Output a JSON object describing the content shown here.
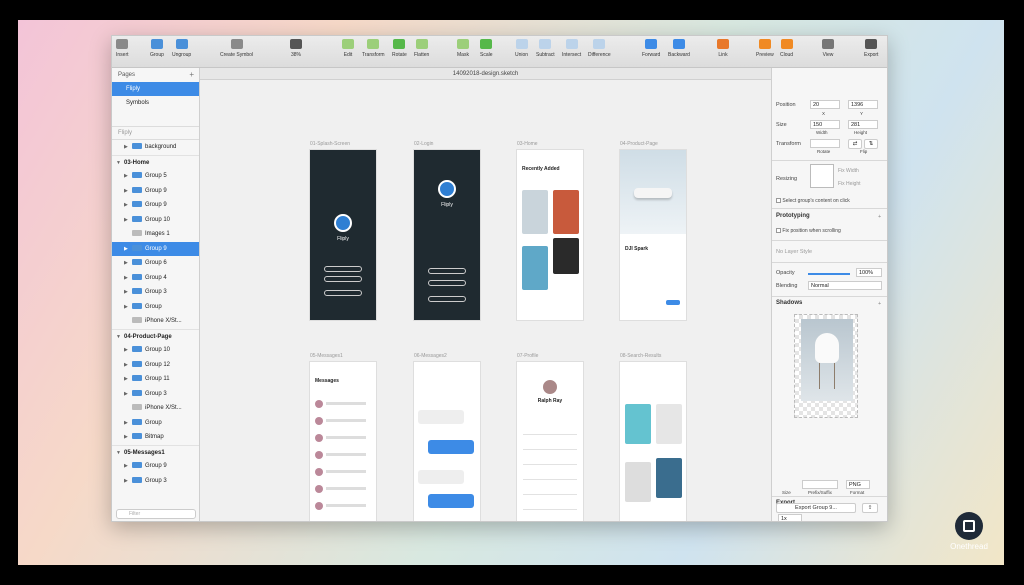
{
  "window": {
    "doc_title": "14092018-design.sketch"
  },
  "toolbar": {
    "items": [
      {
        "label": "Insert",
        "icon": "insert-icon"
      },
      {
        "label": "Group",
        "icon": "group-icon"
      },
      {
        "label": "Ungroup",
        "icon": "ungroup-icon"
      },
      {
        "label": "Create Symbol",
        "icon": "symbol-icon"
      },
      {
        "label": "38%",
        "icon": "zoom-icon"
      },
      {
        "label": "Edit",
        "icon": "edit-icon"
      },
      {
        "label": "Transform",
        "icon": "transform-icon"
      },
      {
        "label": "Rotate",
        "icon": "rotate-icon"
      },
      {
        "label": "Flatten",
        "icon": "flatten-icon"
      },
      {
        "label": "Mask",
        "icon": "mask-icon"
      },
      {
        "label": "Scale",
        "icon": "scale-icon"
      },
      {
        "label": "Union",
        "icon": "union-icon"
      },
      {
        "label": "Subtract",
        "icon": "subtract-icon"
      },
      {
        "label": "Intersect",
        "icon": "intersect-icon"
      },
      {
        "label": "Difference",
        "icon": "difference-icon"
      },
      {
        "label": "Forward",
        "icon": "forward-icon"
      },
      {
        "label": "Backward",
        "icon": "backward-icon"
      },
      {
        "label": "Link",
        "icon": "link-icon"
      },
      {
        "label": "Preview",
        "icon": "preview-icon"
      },
      {
        "label": "Cloud",
        "icon": "cloud-icon"
      },
      {
        "label": "View",
        "icon": "view-icon"
      },
      {
        "label": "Export",
        "icon": "export-icon"
      }
    ]
  },
  "sidebar": {
    "pages_title": "Pages",
    "pages": [
      "Fliply",
      "Symbols"
    ],
    "layers_title": "Fliply",
    "filter_placeholder": "Filter",
    "layers": [
      {
        "label": "background",
        "type": "folder",
        "indent": 1
      },
      {
        "label": "03-Home",
        "type": "artboard",
        "indent": 0
      },
      {
        "label": "Group 5",
        "type": "folder",
        "indent": 1
      },
      {
        "label": "Group 9",
        "type": "folder",
        "indent": 1
      },
      {
        "label": "Group 9",
        "type": "folder",
        "indent": 1
      },
      {
        "label": "Group 10",
        "type": "folder",
        "indent": 1
      },
      {
        "label": "Images 1",
        "type": "image",
        "indent": 1
      },
      {
        "label": "Group 9",
        "type": "folder",
        "indent": 1,
        "selected": true
      },
      {
        "label": "Group 6",
        "type": "folder",
        "indent": 1
      },
      {
        "label": "Group 4",
        "type": "folder",
        "indent": 1
      },
      {
        "label": "Group 3",
        "type": "folder",
        "indent": 1
      },
      {
        "label": "Group",
        "type": "folder",
        "indent": 1
      },
      {
        "label": "iPhone X/St...",
        "type": "image",
        "indent": 1
      },
      {
        "label": "04-Product-Page",
        "type": "artboard",
        "indent": 0
      },
      {
        "label": "Group 10",
        "type": "folder",
        "indent": 1
      },
      {
        "label": "Group 12",
        "type": "folder",
        "indent": 1
      },
      {
        "label": "Group 11",
        "type": "folder",
        "indent": 1
      },
      {
        "label": "Group 3",
        "type": "folder",
        "indent": 1
      },
      {
        "label": "iPhone X/St...",
        "type": "image",
        "indent": 1
      },
      {
        "label": "Group",
        "type": "folder",
        "indent": 1
      },
      {
        "label": "Bitmap",
        "type": "folder",
        "indent": 1
      },
      {
        "label": "05-Messages1",
        "type": "artboard",
        "indent": 0
      },
      {
        "label": "Group 9",
        "type": "folder",
        "indent": 1
      },
      {
        "label": "Group 3",
        "type": "folder",
        "indent": 1
      }
    ]
  },
  "artboards": [
    {
      "name": "01-Splash-Screen",
      "theme": "dark",
      "brand": "Fliply"
    },
    {
      "name": "02-Login",
      "theme": "dark",
      "brand": "Fliply"
    },
    {
      "name": "03-Home",
      "theme": "light",
      "heading": "Recently Added"
    },
    {
      "name": "04-Product-Page",
      "theme": "light",
      "heading": "DJI Spark"
    },
    {
      "name": "05-Messages1",
      "theme": "light",
      "heading": "Messages"
    },
    {
      "name": "06-Messages2",
      "theme": "light",
      "heading": ""
    },
    {
      "name": "07-Profile",
      "theme": "light",
      "heading": "Ralph Ray"
    },
    {
      "name": "08-Search-Results",
      "theme": "light",
      "heading": ""
    }
  ],
  "inspector": {
    "position_label": "Position",
    "x": "20",
    "y": "1396",
    "x_label": "X",
    "y_label": "Y",
    "size_label": "Size",
    "width": "150",
    "height": "281",
    "width_label": "Width",
    "height_label": "Height",
    "transform_label": "Transform",
    "rotate_label": "Rotate",
    "flip_label": "Flip",
    "resizing_label": "Resizing",
    "fix_width": "Fix Width",
    "fix_height": "Fix Height",
    "select_group_label": "Select group's content on click",
    "prototyping_title": "Prototyping",
    "fix_position_label": "Fix position when scrolling",
    "layer_style": "No Layer Style",
    "opacity_label": "Opacity",
    "opacity_value": "100%",
    "blending_label": "Blending",
    "blending_value": "Normal",
    "shadows_title": "Shadows",
    "export_title": "Export",
    "export_size": "1x",
    "export_suffix": "",
    "export_format": "PNG",
    "size_col": "Size",
    "prefix_col": "Prefix/Suffix",
    "format_col": "Format",
    "export_button": "Export Group 9..."
  },
  "brand": {
    "logo_text": "Onethread"
  },
  "colors": {
    "accent": "#3d8be6",
    "dark_artboard": "#1f2a30"
  }
}
